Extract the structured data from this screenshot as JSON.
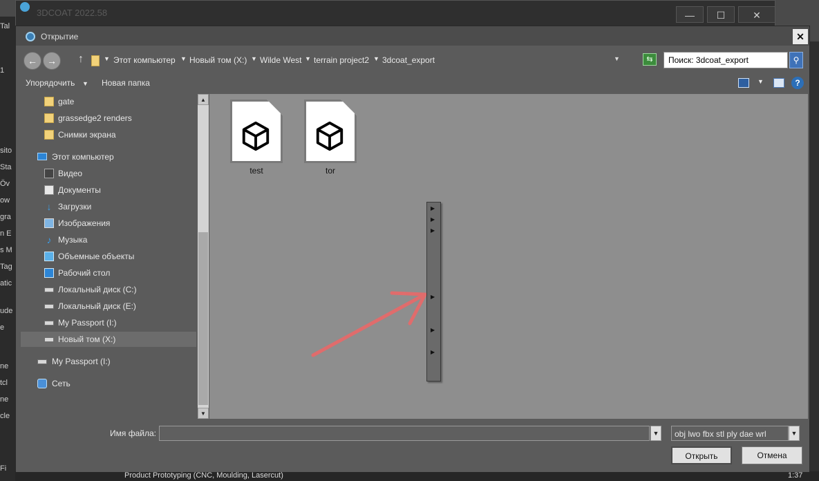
{
  "background_app": {
    "title": "3DCOAT 2022.58",
    "controls": {
      "minimize": "—",
      "maximize": "☐",
      "close": "✕"
    },
    "left_strip_texts": [
      "Tal",
      "1",
      "sito",
      "Sta",
      "Öv",
      "ow",
      "gra",
      "n E",
      "s M",
      "Tag",
      "atic",
      "ude",
      "e",
      "ne",
      "tcl",
      "ne",
      "cle",
      "Fi"
    ],
    "bottom_text": "Product Prototyping (CNC, Moulding, Lasercut)",
    "bottom_time": "1:37"
  },
  "dialog": {
    "title": "Открытие",
    "close_label": "✕",
    "nav": {
      "back": "←",
      "forward": "→",
      "up": "↑",
      "breadcrumbs": [
        "Этот компьютер",
        "Новый том (X:)",
        "Wilde West",
        "terrain project2",
        "3dcoat_export"
      ]
    },
    "search": {
      "value": "Поиск: 3dcoat_export",
      "button": "⚲"
    },
    "toolbar": {
      "organize": "Упорядочить",
      "new_folder": "Новая папка",
      "help": "?"
    },
    "tree": [
      {
        "label": "gate",
        "icon": "folder-icon"
      },
      {
        "label": "grassedge2 renders",
        "icon": "folder-icon"
      },
      {
        "label": "Снимки экрана",
        "icon": "folder-icon"
      },
      {
        "label": "Этот компьютер",
        "icon": "computer-icon"
      },
      {
        "label": "Видео",
        "icon": "video-icon"
      },
      {
        "label": "Документы",
        "icon": "documents-icon"
      },
      {
        "label": "Загрузки",
        "icon": "downloads-icon"
      },
      {
        "label": "Изображения",
        "icon": "pictures-icon"
      },
      {
        "label": "Музыка",
        "icon": "music-icon"
      },
      {
        "label": "Объемные объекты",
        "icon": "3d-objects-icon"
      },
      {
        "label": "Рабочий стол",
        "icon": "desktop-icon"
      },
      {
        "label": "Локальный диск (C:)",
        "icon": "drive-icon"
      },
      {
        "label": "Локальный диск (E:)",
        "icon": "drive-icon"
      },
      {
        "label": "My Passport (I:)",
        "icon": "drive-icon"
      },
      {
        "label": "Новый том (X:)",
        "icon": "drive-icon",
        "selected": true
      },
      {
        "label": "My Passport (I:)",
        "icon": "drive-icon"
      },
      {
        "label": "Сеть",
        "icon": "network-icon"
      }
    ],
    "files": [
      {
        "name": "test",
        "icon": "3d-model-file-icon"
      },
      {
        "name": "tor",
        "icon": "3d-model-file-icon"
      }
    ],
    "bottom": {
      "filename_label": "Имя файла:",
      "filename_value": "",
      "filetype": "obj lwo fbx stl ply dae wrl",
      "open": "Открыть",
      "cancel": "Отмена"
    },
    "annotation_arrow_color": "#e06c6c"
  }
}
